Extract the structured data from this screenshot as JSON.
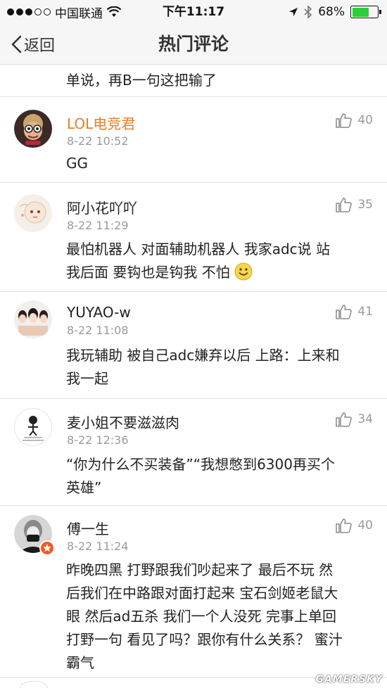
{
  "status_bar": {
    "carrier": "中国联通",
    "time": "下午11:17",
    "battery_percent": "68%",
    "battery_level": 0.68
  },
  "nav": {
    "back_label": "返回",
    "title": "热门评论"
  },
  "partial_comment": {
    "text": "单说，再B一句这把输了"
  },
  "comments": [
    {
      "username": "LOL电竞君",
      "time": "8-22 10:52",
      "likes": "40",
      "lines": [
        "GG"
      ]
    },
    {
      "username": "阿小花吖吖",
      "time": "8-22 11:29",
      "likes": "35",
      "lines": [
        "最怕机器人  对面辅助机器人 我家adc说  站",
        "我后面  要钩也是钩我  不怕"
      ]
    },
    {
      "username": "YUYAO-w",
      "time": "8-22 11:08",
      "likes": "41",
      "lines": [
        "我玩辅助 被自己adc嫌弃以后 上路：上来和",
        "我一起"
      ]
    },
    {
      "username": "麦小姐不要滋滋肉",
      "time": "8-22 12:36",
      "likes": "34",
      "lines": [
        "“你为什么不买装备”“我想憋到6300再买个",
        "英雄”"
      ]
    },
    {
      "username": "傅一生",
      "time": "8-22 11:24",
      "likes": "40",
      "lines": [
        "昨晚四黑  打野跟我们吵起来了  最后不玩  然",
        "后我们在中路跟对面打起来  宝石剑姬老鼠大",
        "眼  然后ad五杀  我们一个人没死  完事上单回",
        "打野一句  看见了吗？跟你有什么关系？  蜜汁",
        "霸气"
      ]
    }
  ],
  "watermark": "GAMERSKY",
  "colors": {
    "highlight_username": "#ea7d24",
    "battery_green": "#2bcf3b",
    "meta_gray": "#9a9a9a"
  },
  "icons": [
    "signal-dots-icon",
    "wifi-icon",
    "location-arrow-icon",
    "bluetooth-icon",
    "battery-icon",
    "back-chevron-icon",
    "thumbs-up-icon",
    "smile-emoji-icon"
  ]
}
